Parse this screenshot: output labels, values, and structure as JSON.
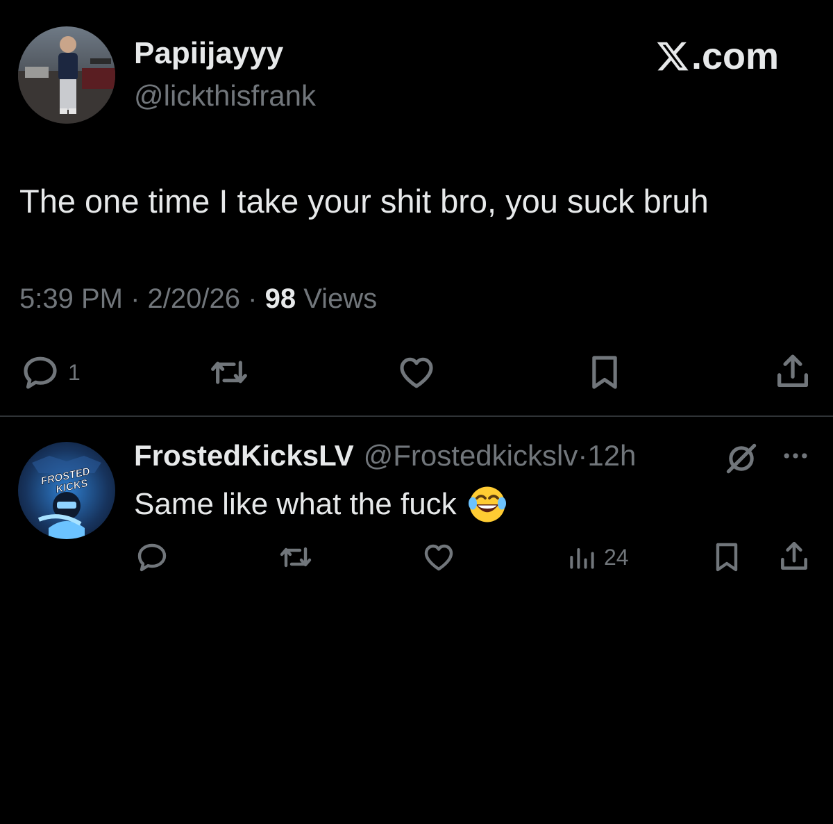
{
  "main_tweet": {
    "display_name": "Papiijayyy",
    "handle": "@lickthisfrank",
    "text": "The one time I take your shit bro, you suck bruh",
    "time": "5:39 PM",
    "date": "2/20/26",
    "views_count": "98",
    "views_label": "Views",
    "separator": "·",
    "reply_count": "1",
    "icons": [
      "reply-icon",
      "retweet-icon",
      "like-icon",
      "bookmark-icon",
      "share-icon"
    ]
  },
  "brand": {
    "logo_letter": "X",
    "suffix": ".com"
  },
  "reply_tweet": {
    "display_name": "FrostedKicksLV",
    "handle": "@Frostedkickslv",
    "separator": "·",
    "time": "12h",
    "text": "Same like what the fuck",
    "emoji": "😂",
    "avatar_text_line1": "FROSTED",
    "avatar_text_line2": "KICKS",
    "views_count": "24",
    "icons": [
      "grok-icon",
      "more-icon",
      "reply-icon",
      "retweet-icon",
      "like-icon",
      "analytics-icon",
      "bookmark-icon",
      "share-icon"
    ]
  },
  "colors": {
    "background": "#000000",
    "text": "#e7e9ea",
    "muted": "#71767b",
    "divider": "#2f3336"
  }
}
